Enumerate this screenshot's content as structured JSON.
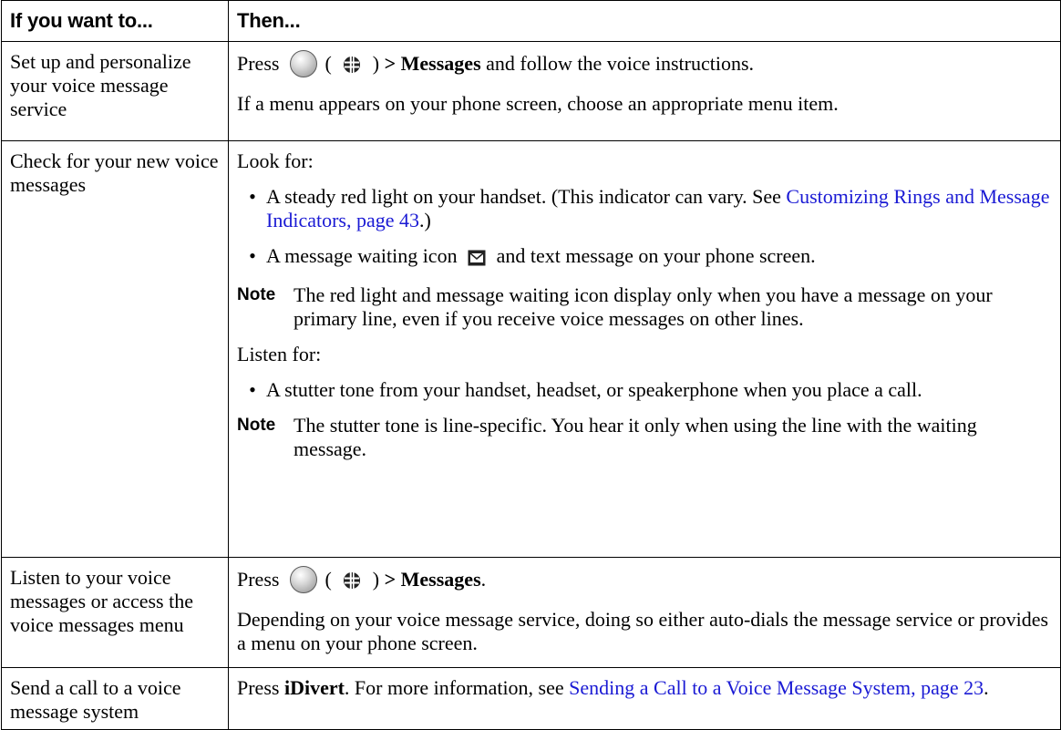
{
  "table": {
    "header": {
      "col1": "If you want to...",
      "col2": "Then..."
    },
    "row1": {
      "task": "Set up and personalize your voice message service",
      "press": "Press",
      "paren_open": "(",
      "paren_close": ")",
      "arrow_messages": "> Messages",
      "rest": " and follow the voice instructions.",
      "p2": "If a menu appears on your phone screen, choose an appropriate menu item."
    },
    "row2": {
      "task": "Check for your new voice messages",
      "look_for": "Look for:",
      "bullet1_text": "A steady red light on your handset. (This indicator can vary. See ",
      "bullet1_link": "Customizing Rings and Message Indicators, page 43",
      "bullet1_tail": ".)",
      "bullet2_pre": "A message waiting icon",
      "bullet2_post": "and text message on your phone screen.",
      "note_label": "Note",
      "note1": "The red light and message waiting icon display only when you have a message on your primary line, even if you receive voice messages on other lines.",
      "listen_for": "Listen for:",
      "bullet3": "A stutter tone from your handset, headset, or speakerphone when you place a call.",
      "note2": "The stutter tone is line-specific. You hear it only when using the line with the waiting message."
    },
    "row3": {
      "task": "Listen to your voice messages or access the voice messages menu",
      "press": "Press",
      "paren_open": "(",
      "paren_close": ")",
      "arrow_messages": "> Messages",
      "period": ".",
      "p2": "Depending on your voice message service, doing so either auto-dials the message service or provides a menu on your phone screen."
    },
    "row4": {
      "task": "Send a call to a voice message system",
      "press": "Press ",
      "idivert": "iDivert",
      "mid": ". For more information, see ",
      "link": "Sending a Call to a Voice Message System, page 23",
      "tail": "."
    }
  },
  "icons": {
    "menu_button": "round-menu-button-icon",
    "services": "services-globe-icon",
    "message_waiting": "message-waiting-envelope-icon"
  },
  "colors": {
    "link": "#1a1ad4",
    "border": "#000000"
  }
}
